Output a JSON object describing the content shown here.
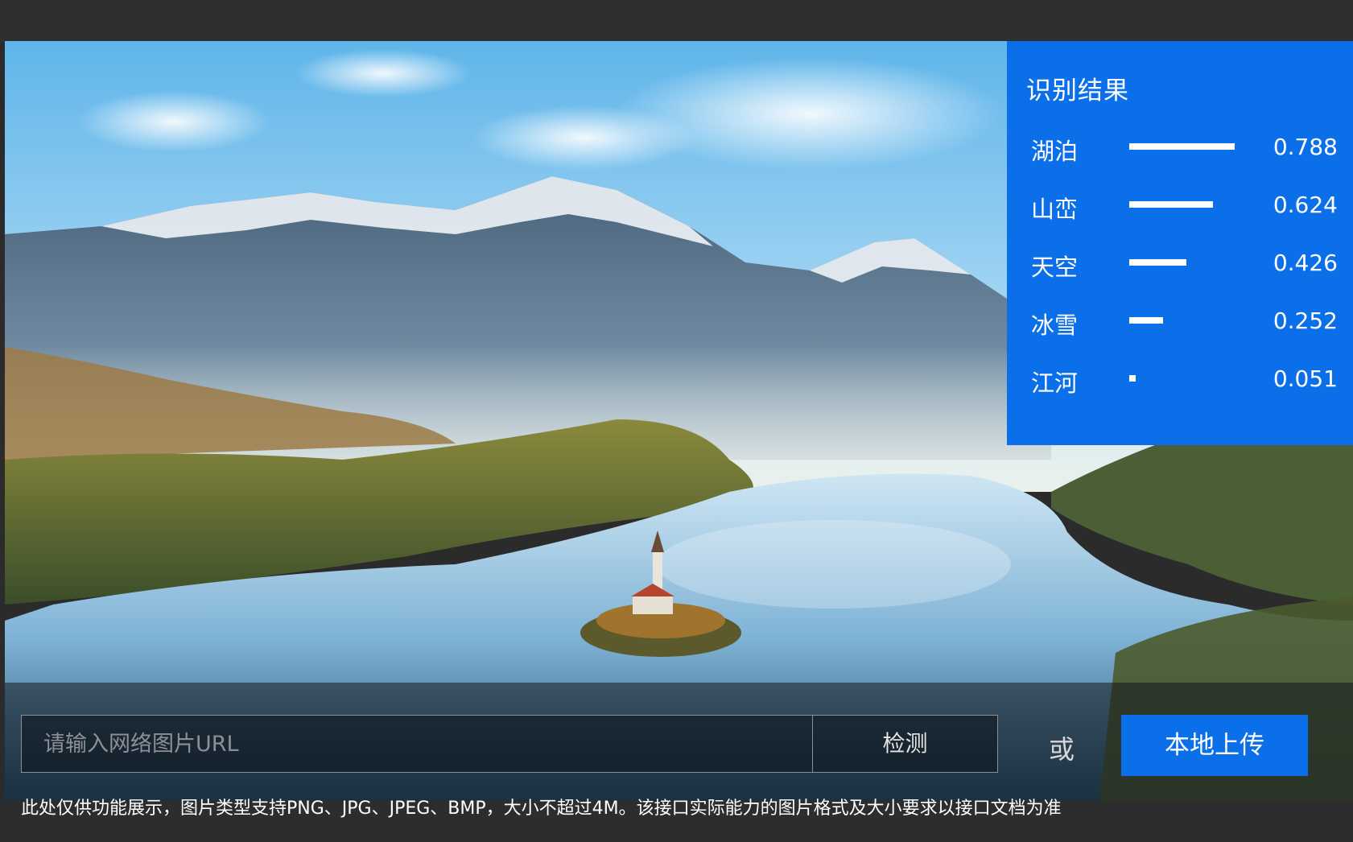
{
  "result": {
    "title": "识别结果",
    "items": [
      {
        "label": "湖泊",
        "score": "0.788",
        "value": 0.788
      },
      {
        "label": "山峦",
        "score": "0.624",
        "value": 0.624
      },
      {
        "label": "天空",
        "score": "0.426",
        "value": 0.426
      },
      {
        "label": "冰雪",
        "score": "0.252",
        "value": 0.252
      },
      {
        "label": "江河",
        "score": "0.051",
        "value": 0.051
      }
    ]
  },
  "controls": {
    "url_placeholder": "请输入网络图片URL",
    "detect_label": "检测",
    "or_label": "或",
    "upload_label": "本地上传"
  },
  "note": "此处仅供功能展示，图片类型支持PNG、JPG、JPEG、BMP，大小不超过4M。该接口实际能力的图片格式及大小要求以接口文档为准",
  "colors": {
    "accent": "#0a6fe8",
    "background": "#2b2b2b"
  }
}
